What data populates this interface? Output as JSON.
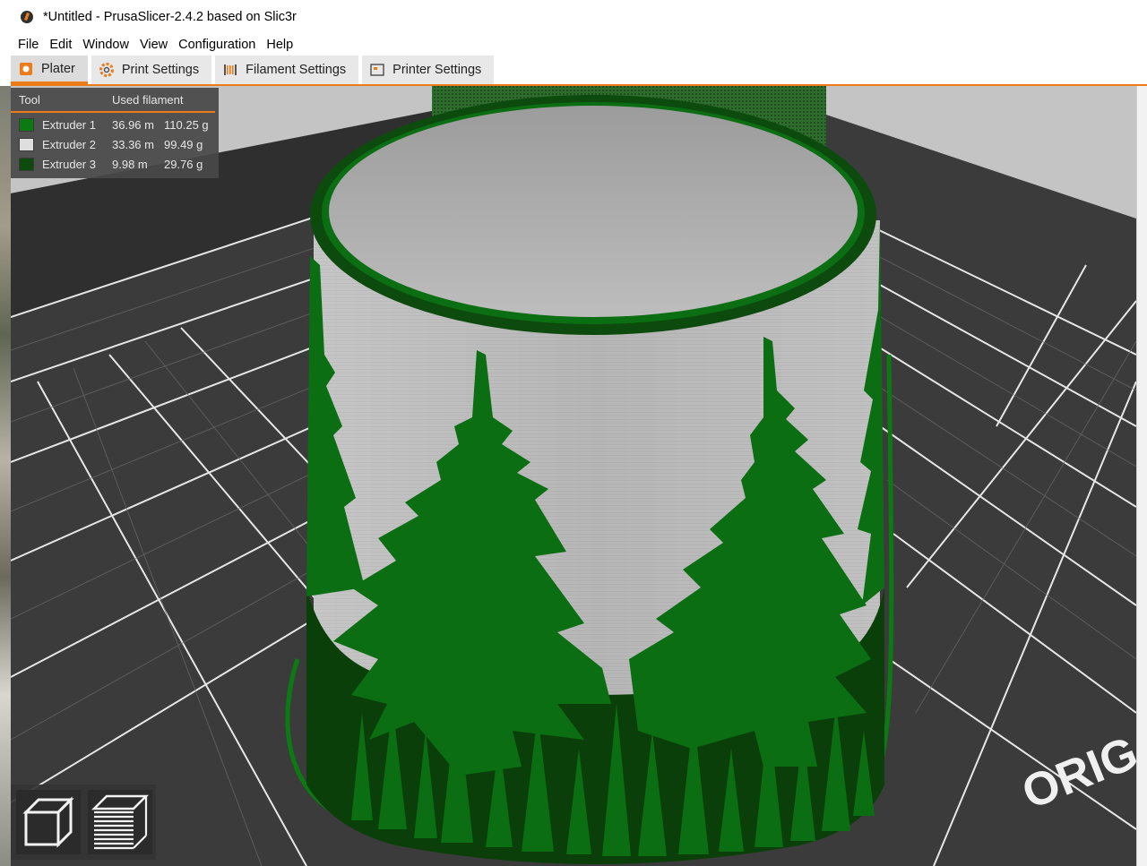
{
  "window": {
    "title": "*Untitled - PrusaSlicer-2.4.2 based on Slic3r"
  },
  "menu": [
    "File",
    "Edit",
    "Window",
    "View",
    "Configuration",
    "Help"
  ],
  "tabs": [
    {
      "label": "Plater",
      "icon": "plater-icon",
      "active": true
    },
    {
      "label": "Print Settings",
      "icon": "gear-icon",
      "active": false
    },
    {
      "label": "Filament Settings",
      "icon": "filament-spool-icon",
      "active": false
    },
    {
      "label": "Printer Settings",
      "icon": "printer-icon",
      "active": false
    }
  ],
  "legend": {
    "header_tool": "Tool",
    "header_used": "Used filament",
    "rows": [
      {
        "name": "Extruder 1",
        "length": "36.96 m",
        "weight": "110.25 g",
        "color": "#0b7a12"
      },
      {
        "name": "Extruder 2",
        "length": "33.36 m",
        "weight": "99.49 g",
        "color": "#dedede"
      },
      {
        "name": "Extruder 3",
        "length": "9.98 m",
        "weight": "29.76 g",
        "color": "#0d4a0d"
      }
    ]
  },
  "bed": {
    "label": "ORIG"
  },
  "view_buttons": [
    {
      "name": "3d-view-button",
      "icon": "cube-icon"
    },
    {
      "name": "preview-button",
      "icon": "layers-icon"
    }
  ],
  "colors": {
    "accent": "#ec7b19",
    "bed_tile": "#3a3a3a",
    "grid_line": "#e8e8e8",
    "object_gray": "#b8b8b8",
    "tree_green": "#0b6e12",
    "dark_green": "#0a3f0a"
  }
}
